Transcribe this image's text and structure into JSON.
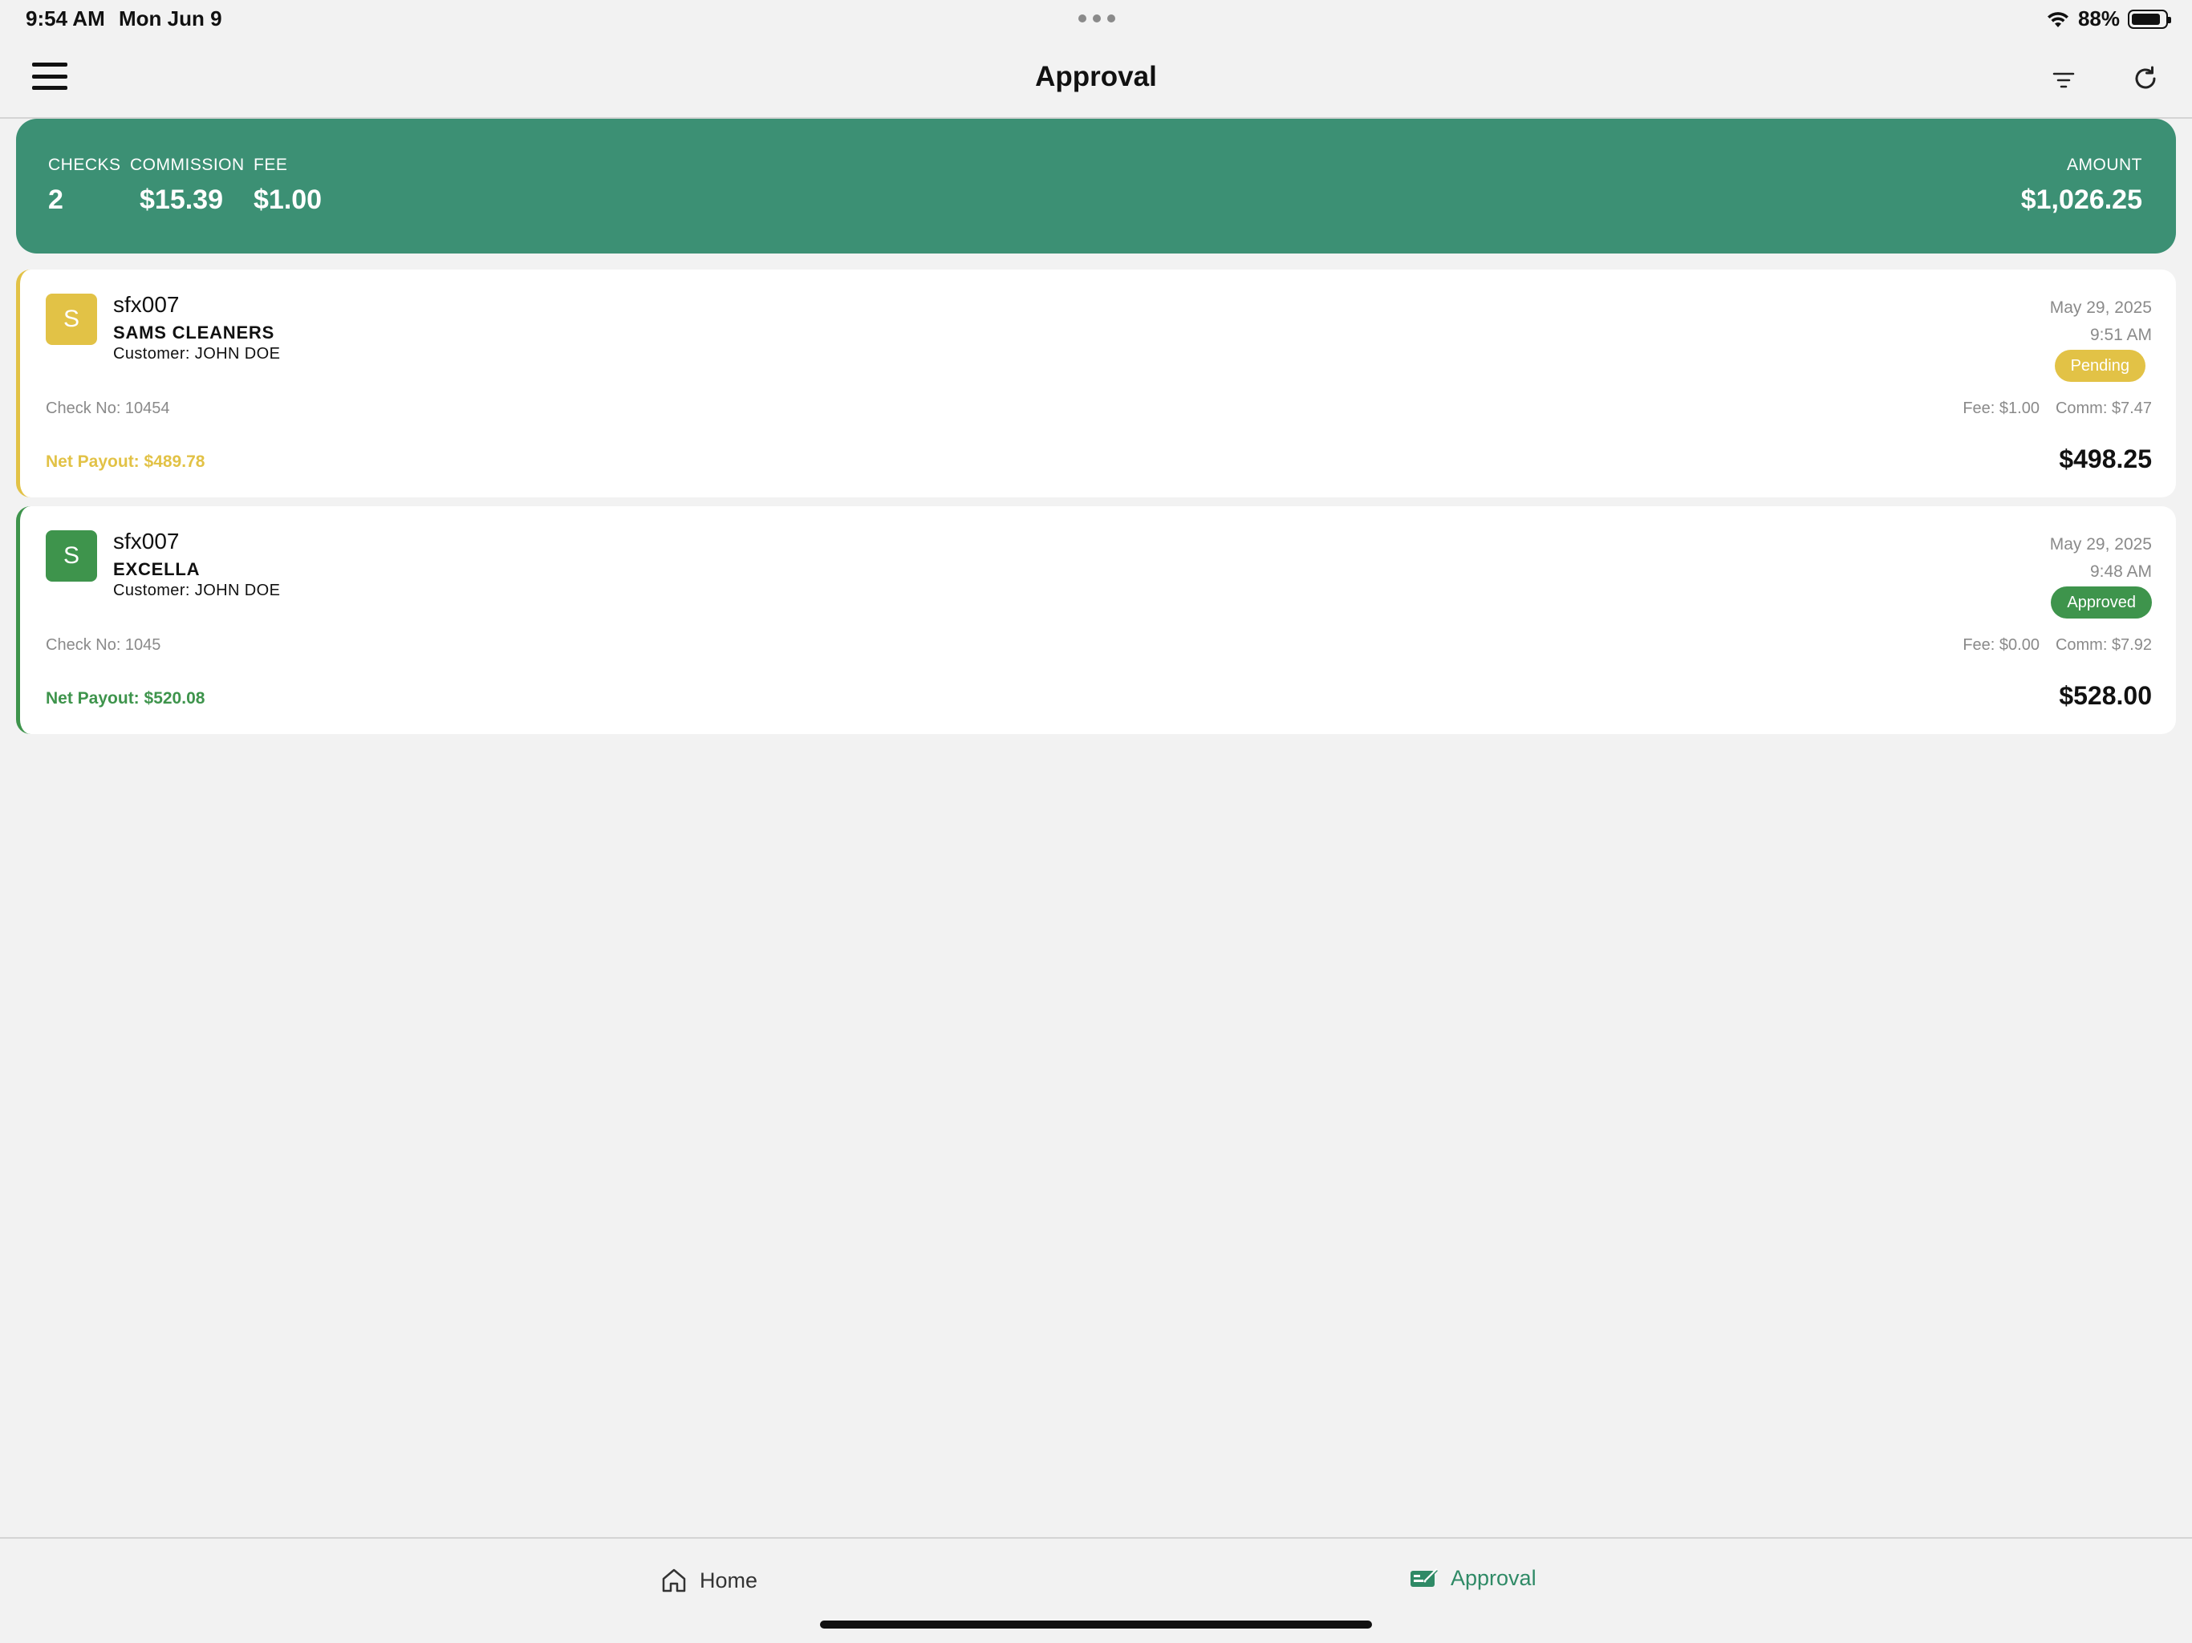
{
  "status_bar": {
    "time": "9:54 AM",
    "date": "Mon Jun 9",
    "battery": "88%"
  },
  "nav": {
    "title": "Approval"
  },
  "summary": {
    "checks_label": "CHECKS",
    "checks_value": "2",
    "commission_label": "COMMISSION",
    "commission_value": "$15.39",
    "fee_label": "FEE",
    "fee_value": "$1.00",
    "amount_label": "AMOUNT",
    "amount_value": "$1,026.25",
    "color": "#3c9074"
  },
  "checks": [
    {
      "avatar_letter": "S",
      "user_id": "sfx007",
      "merchant": "SAMS CLEANERS",
      "customer": "Customer: JOHN DOE",
      "date": "May 29, 2025",
      "time": "9:51 AM",
      "status": "Pending",
      "check_no": "Check No: 10454",
      "fee": "Fee: $1.00",
      "comm": "Comm: $7.47",
      "net_payout": "Net Payout: $489.78",
      "amount": "$498.25",
      "color": "#e2c246"
    },
    {
      "avatar_letter": "S",
      "user_id": "sfx007",
      "merchant": "EXCELLA",
      "customer": "Customer: JOHN DOE",
      "date": "May 29, 2025",
      "time": "9:48 AM",
      "status": "Approved",
      "check_no": "Check No: 1045",
      "fee": "Fee: $0.00",
      "comm": "Comm: $7.92",
      "net_payout": "Net Payout: $520.08",
      "amount": "$528.00",
      "color": "#3e944c"
    }
  ],
  "tabs": {
    "home_label": "Home",
    "approval_label": "Approval",
    "active_color": "#2f8a66"
  }
}
